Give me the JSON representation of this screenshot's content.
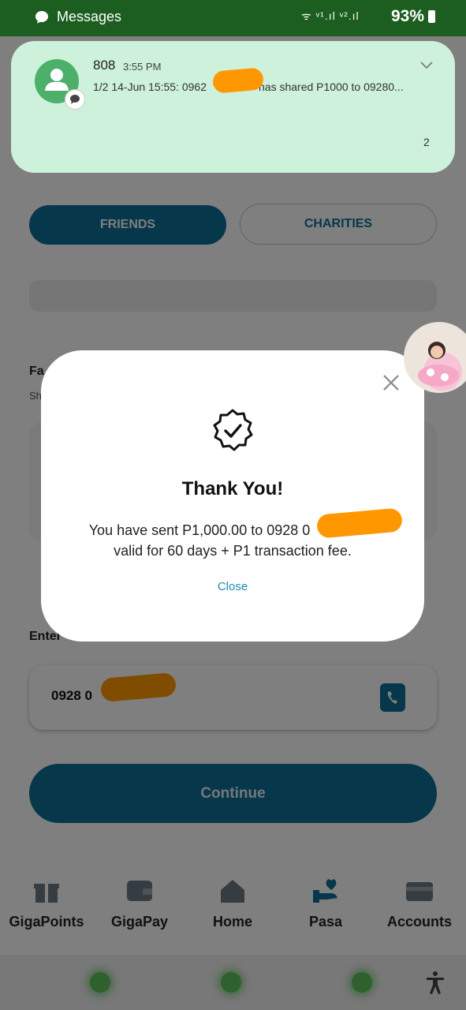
{
  "status_bar": {
    "app_title": "Messages",
    "signal_text": "ᯤ  ᵛ¹.ıl ᵛ².ıl",
    "battery": "93%"
  },
  "tabs": {
    "friends": "FRIENDS",
    "charities": "CHARITIES"
  },
  "favorites": {
    "label": "Fa",
    "sub": "Sh"
  },
  "recipient": {
    "label": "Enter",
    "number_prefix": "0928 0"
  },
  "continue_label": "Continue",
  "nav": [
    {
      "label": "GigaPoints",
      "icon": "gift-icon"
    },
    {
      "label": "GigaPay",
      "icon": "wallet-icon"
    },
    {
      "label": "Home",
      "icon": "home-icon"
    },
    {
      "label": "Pasa",
      "icon": "pasa-icon"
    },
    {
      "label": "Accounts",
      "icon": "card-icon"
    }
  ],
  "notification": {
    "sender": "808",
    "time": "3:55 PM",
    "body_start": "1/2 14-Jun 15:55: 0962",
    "body_end": "has shared P1000 to 09280...",
    "count": "2"
  },
  "modal": {
    "title": "Thank You!",
    "message_line1_start": "You have sent P1,000.00 to 0928 0",
    "message_line2": "valid for 60 days + P1 transaction fee.",
    "close_label": "Close"
  },
  "colors": {
    "primary": "#0e6f96",
    "status_bar": "#1b5e20",
    "notification_bg": "#cdf1da",
    "redaction": "#ff9800"
  }
}
